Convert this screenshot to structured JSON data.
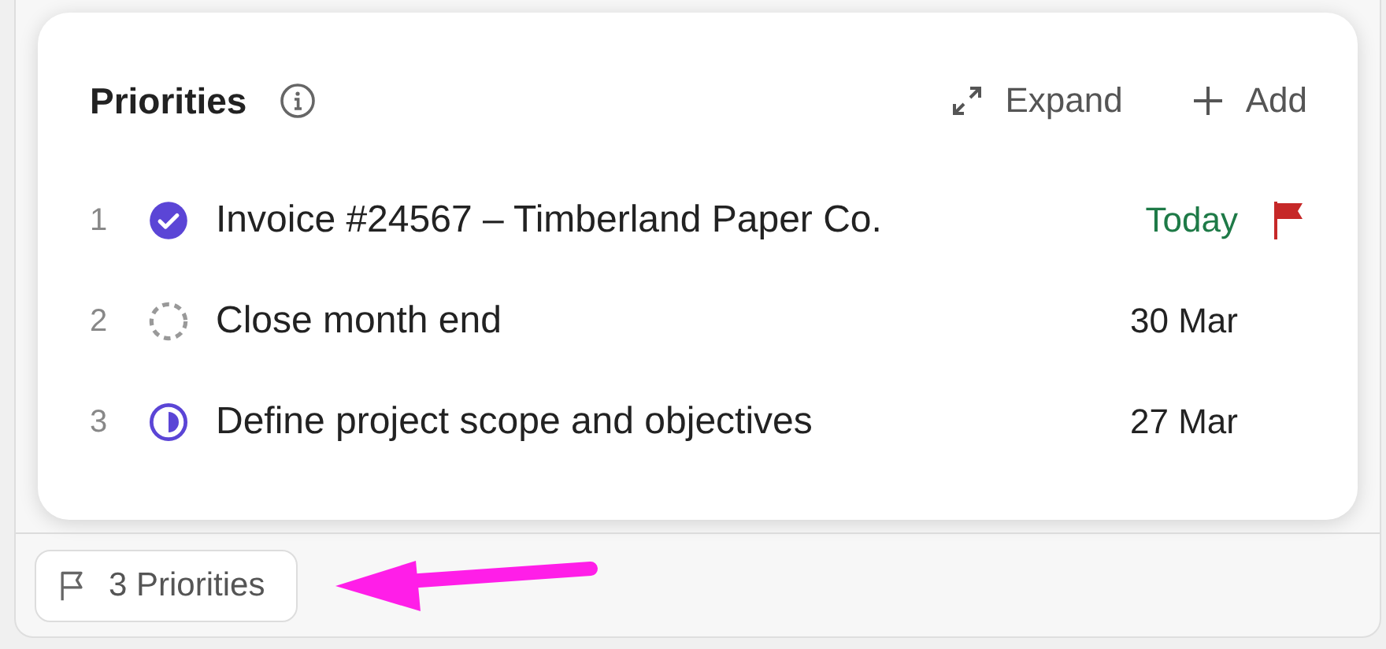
{
  "popover": {
    "title": "Priorities",
    "actions": [
      {
        "kind": "expand",
        "label": "Expand"
      },
      {
        "kind": "add",
        "label": "Add"
      }
    ],
    "items": [
      {
        "number": "1",
        "kind": "done",
        "title": "Invoice #24567 – Timberland Paper Co.",
        "due": "Today",
        "due_today": true,
        "flagged": true
      },
      {
        "number": "2",
        "kind": "todo",
        "title": "Close month end",
        "due": "30 Mar",
        "due_today": false,
        "flagged": false
      },
      {
        "number": "3",
        "kind": "partial",
        "title": "Define project scope and objectives",
        "due": "27 Mar",
        "due_today": false,
        "flagged": false
      }
    ]
  },
  "footer": {
    "priorities_button": "3 Priorities"
  }
}
